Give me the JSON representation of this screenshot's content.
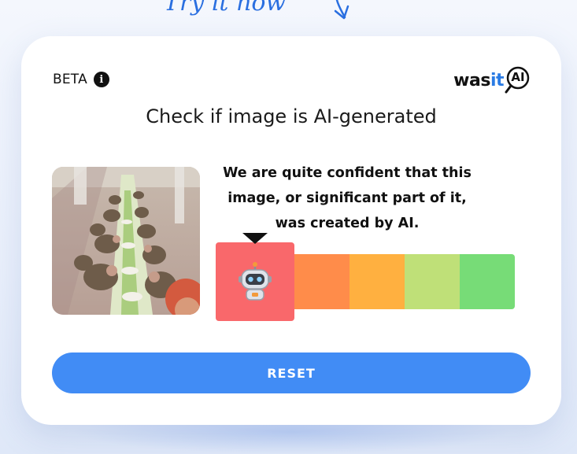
{
  "header": {
    "tagline": "Try it now"
  },
  "card": {
    "beta_label": "BETA",
    "logo": {
      "part_was": "was",
      "part_it": "it",
      "part_ai": "AI"
    },
    "title": "Check if image is AI-generated",
    "verdict": "We are quite confident that this image, or significant part of it, was created by AI.",
    "result_level": "1 of 5",
    "reset_label": "RESET"
  },
  "icons": {
    "info": "info-icon",
    "robot": "robot-icon",
    "magnifier": "magnifier-icon",
    "arrow": "hand-drawn-arrow-icon"
  },
  "colors": {
    "accent": "#418cf5",
    "logo_blue": "#2a7be4",
    "meter": [
      "#f9686b",
      "#ff8c4a",
      "#ffb040",
      "#bfe078",
      "#77dc77"
    ]
  }
}
